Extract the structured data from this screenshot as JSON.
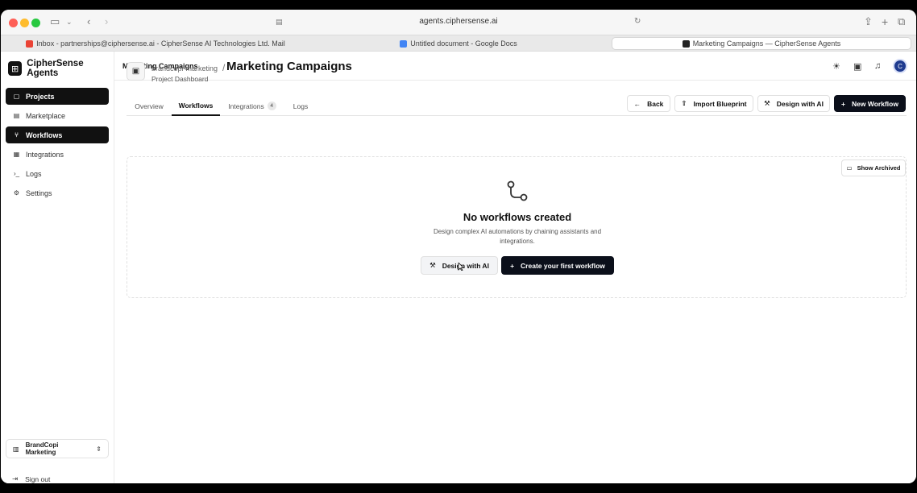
{
  "browser": {
    "url": "agents.ciphersense.ai",
    "tabs": [
      {
        "label": "Inbox - partnerships@ciphersense.ai - CipherSense AI Technologies Ltd. Mail",
        "active": false
      },
      {
        "label": "Untitled document - Google Docs",
        "active": false
      },
      {
        "label": "Marketing Campaigns — CipherSense Agents",
        "active": true
      }
    ]
  },
  "brand": {
    "name": "CipherSense Agents"
  },
  "sidebar": {
    "items": [
      {
        "label": "Projects",
        "icon": "folder-icon",
        "active": true
      },
      {
        "label": "Marketplace",
        "icon": "store-icon",
        "active": false
      },
      {
        "label": "Workflows",
        "icon": "workflow-icon",
        "active": true
      },
      {
        "label": "Integrations",
        "icon": "grid-icon",
        "active": false
      },
      {
        "label": "Logs",
        "icon": "terminal-icon",
        "active": false
      },
      {
        "label": "Settings",
        "icon": "gear-icon",
        "active": false
      }
    ],
    "org": "BrandCopi Marketing",
    "signout": "Sign out"
  },
  "topbar": {
    "title": "Marketing Campaigns",
    "avatar_initial": "C"
  },
  "header": {
    "breadcrumb_parent": "brandcopi-marketing",
    "breadcrumb_sep": "/",
    "title": "Marketing Campaigns",
    "subtitle": "Project Dashboard"
  },
  "actions": {
    "back": "Back",
    "import": "Import Blueprint",
    "design_ai": "Design with AI",
    "new_workflow": "New Workflow"
  },
  "tabs": [
    {
      "label": "Overview",
      "active": false
    },
    {
      "label": "Workflows",
      "active": true
    },
    {
      "label": "Integrations",
      "active": false,
      "badge": "4"
    },
    {
      "label": "Logs",
      "active": false
    }
  ],
  "show_archived": "Show Archived",
  "empty_state": {
    "title": "No workflows created",
    "description": "Design complex AI automations by chaining assistants and integrations.",
    "design_ai": "Design with AI",
    "create": "Create your first workflow"
  },
  "colors": {
    "primary": "#0b0f1a",
    "sidebar_active": "#111111",
    "avatar": "#1f3b8f"
  }
}
